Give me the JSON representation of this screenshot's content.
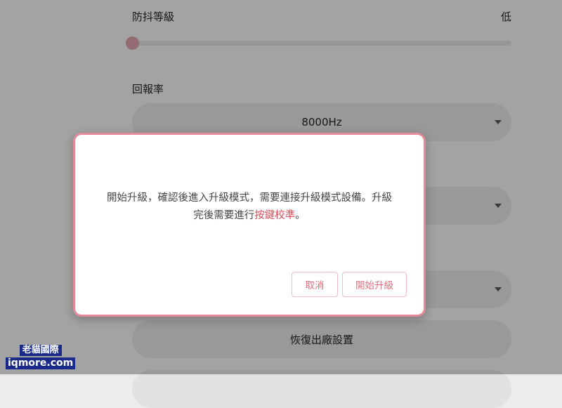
{
  "settings": {
    "debounce_label": "防抖等級",
    "debounce_value": "低",
    "debounce_level": 0,
    "polling_label": "回報率",
    "polling_value": "8000Hz",
    "reset_label": "恢復出廠設置"
  },
  "dialog": {
    "message_part1": "開始升級，確認後進入升級模式，需要連接升級模式設備。升級完後需要進行",
    "message_highlight": "按鍵校準",
    "message_part2": "。",
    "cancel_label": "取消",
    "confirm_label": "開始升級"
  },
  "watermark": {
    "line1": "老貓國際",
    "line2": "iqmore.com"
  },
  "colors": {
    "accent": "#e46d7d",
    "dialog_border": "#e78a97",
    "highlight_text": "#d94a5a"
  }
}
